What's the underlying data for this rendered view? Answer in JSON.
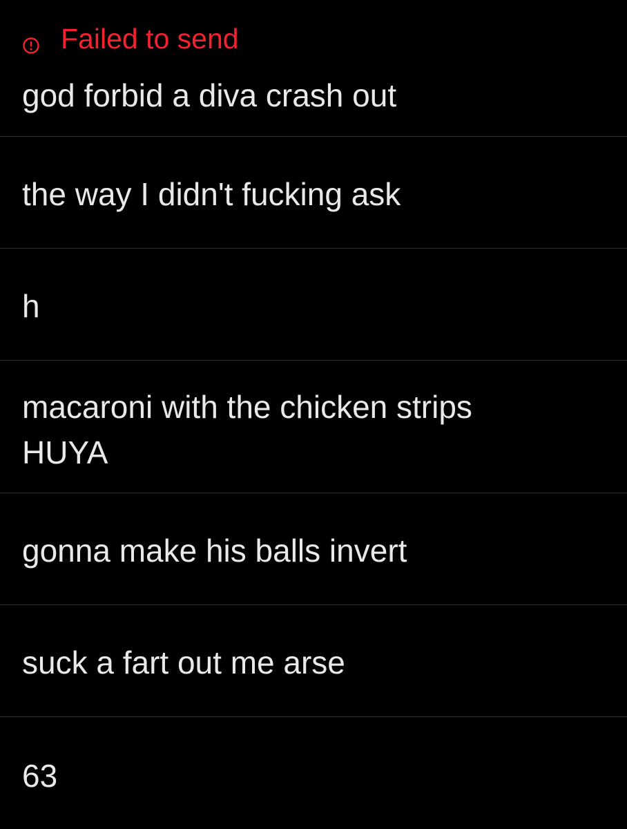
{
  "status": {
    "icon": "alert-circle-icon",
    "text": "Failed to send",
    "color": "#f4212e"
  },
  "colors": {
    "background": "#000000",
    "text": "#e7e9ea",
    "divider": "#2a2d30"
  },
  "messages": [
    {
      "text": "god forbid a diva crash out"
    },
    {
      "text": "the way I didn't fucking ask"
    },
    {
      "text": "h"
    },
    {
      "text": "macaroni with the chicken strips\nHUYA"
    },
    {
      "text": "gonna make his balls invert"
    },
    {
      "text": "suck a fart out me arse"
    },
    {
      "text": "63"
    }
  ]
}
